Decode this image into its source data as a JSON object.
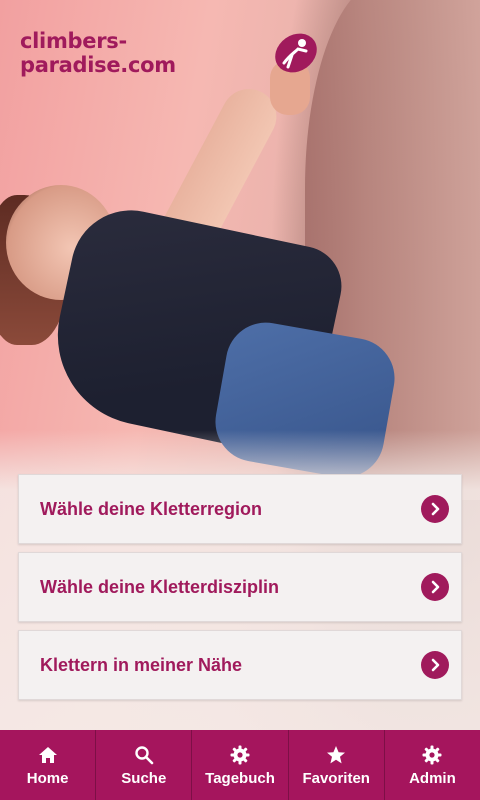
{
  "brand": {
    "logo_text": "climbers-paradise.com",
    "accent_color": "#a01a5c"
  },
  "menu": {
    "items": [
      {
        "label": "Wähle deine Kletterregion",
        "icon": "chevron-right-icon"
      },
      {
        "label": "Wähle deine Kletterdisziplin",
        "icon": "chevron-right-icon"
      },
      {
        "label": "Klettern in meiner Nähe",
        "icon": "chevron-right-icon"
      }
    ]
  },
  "tabbar": {
    "background": "#a5155d",
    "tabs": [
      {
        "label": "Home",
        "icon": "home-icon"
      },
      {
        "label": "Suche",
        "icon": "search-icon"
      },
      {
        "label": "Tagebuch",
        "icon": "gear-icon"
      },
      {
        "label": "Favoriten",
        "icon": "star-icon"
      },
      {
        "label": "Admin",
        "icon": "gear-icon"
      }
    ]
  }
}
